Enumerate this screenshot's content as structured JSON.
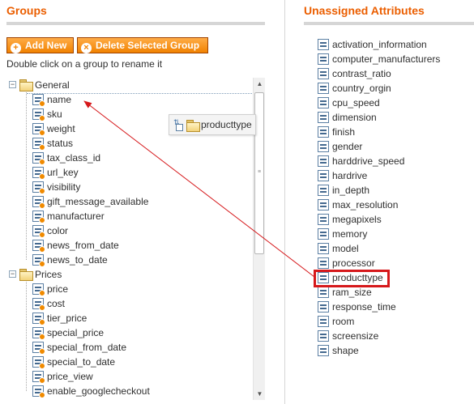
{
  "groups_panel": {
    "title": "Groups",
    "add_button": "Add New",
    "delete_button": "Delete Selected Group",
    "hint": "Double click on a group to rename it",
    "tree": [
      {
        "name": "General",
        "items": [
          "name",
          "sku",
          "weight",
          "status",
          "tax_class_id",
          "url_key",
          "visibility",
          "gift_message_available",
          "manufacturer",
          "color",
          "news_from_date",
          "news_to_date"
        ]
      },
      {
        "name": "Prices",
        "items": [
          "price",
          "cost",
          "tier_price",
          "special_price",
          "special_from_date",
          "special_to_date",
          "price_view",
          "enable_googlecheckout"
        ]
      }
    ],
    "drag_label": "producttype"
  },
  "unassigned_panel": {
    "title": "Unassigned Attributes",
    "items": [
      "activation_information",
      "computer_manufacturers",
      "contrast_ratio",
      "country_orgin",
      "cpu_speed",
      "dimension",
      "finish",
      "gender",
      "harddrive_speed",
      "hardrive",
      "in_depth",
      "max_resolution",
      "megapixels",
      "memory",
      "model",
      "processor",
      "producttype",
      "ram_size",
      "response_time",
      "room",
      "screensize",
      "shape"
    ],
    "highlighted": "producttype"
  },
  "colors": {
    "accent": "#eb5e00",
    "button": "#f18200",
    "highlight_box": "#d6181b",
    "arrow": "#d6181b"
  },
  "icons": [
    "folder-icon",
    "attribute-icon",
    "plus-icon",
    "delete-icon",
    "drag-icon"
  ]
}
